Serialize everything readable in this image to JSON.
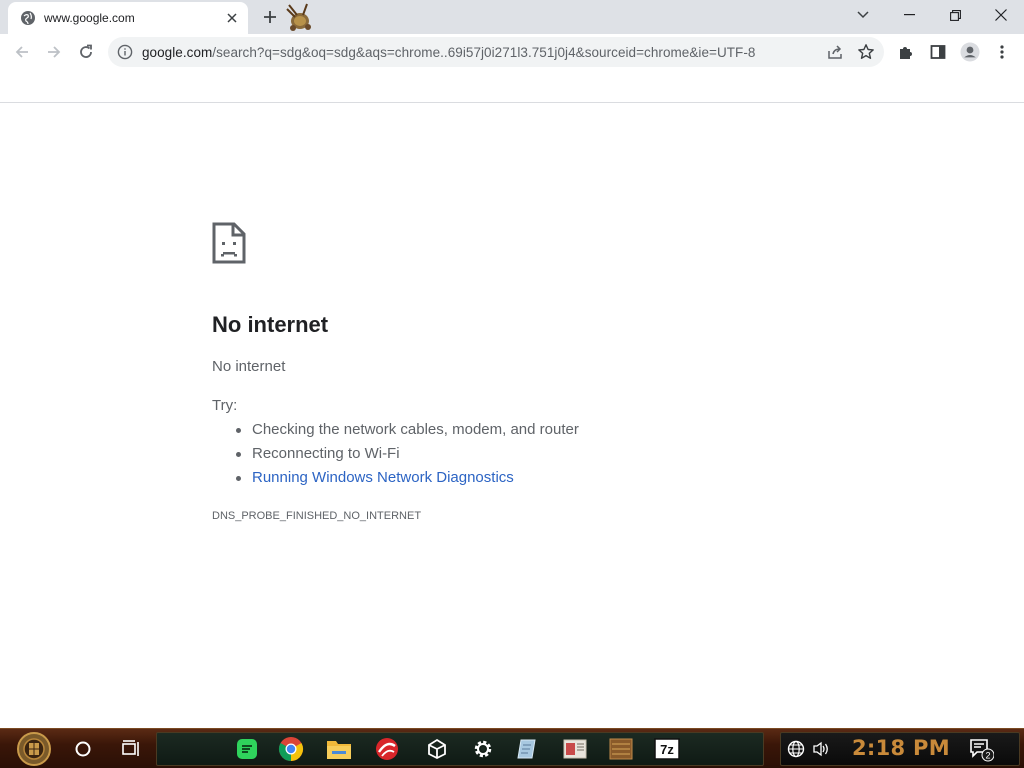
{
  "browser": {
    "tab": {
      "title": "www.google.com"
    },
    "address": {
      "host": "google.com",
      "path": "/search?q=sdg&oq=sdg&aqs=chrome..69i57j0i271l3.751j0j4&sourceid=chrome&ie=UTF-8"
    }
  },
  "error_page": {
    "title": "No internet",
    "subtitle": "No internet",
    "try_label": "Try:",
    "suggestions": [
      "Checking the network cables, modem, and router",
      "Reconnecting to Wi-Fi",
      "Running Windows Network Diagnostics"
    ],
    "error_code": "DNS_PROBE_FINISHED_NO_INTERNET",
    "link_color": "#2c64c4"
  },
  "taskbar": {
    "clock": "2:18 PM",
    "notification_count": "2",
    "apps": [
      "spotify-icon",
      "chrome-icon",
      "file-explorer-icon",
      "app-red-icon",
      "unity-icon",
      "settings-icon",
      "notes-icon",
      "app-window-icon",
      "app-wood-icon",
      "7zip-icon"
    ],
    "seven_zip_label": "7z"
  }
}
